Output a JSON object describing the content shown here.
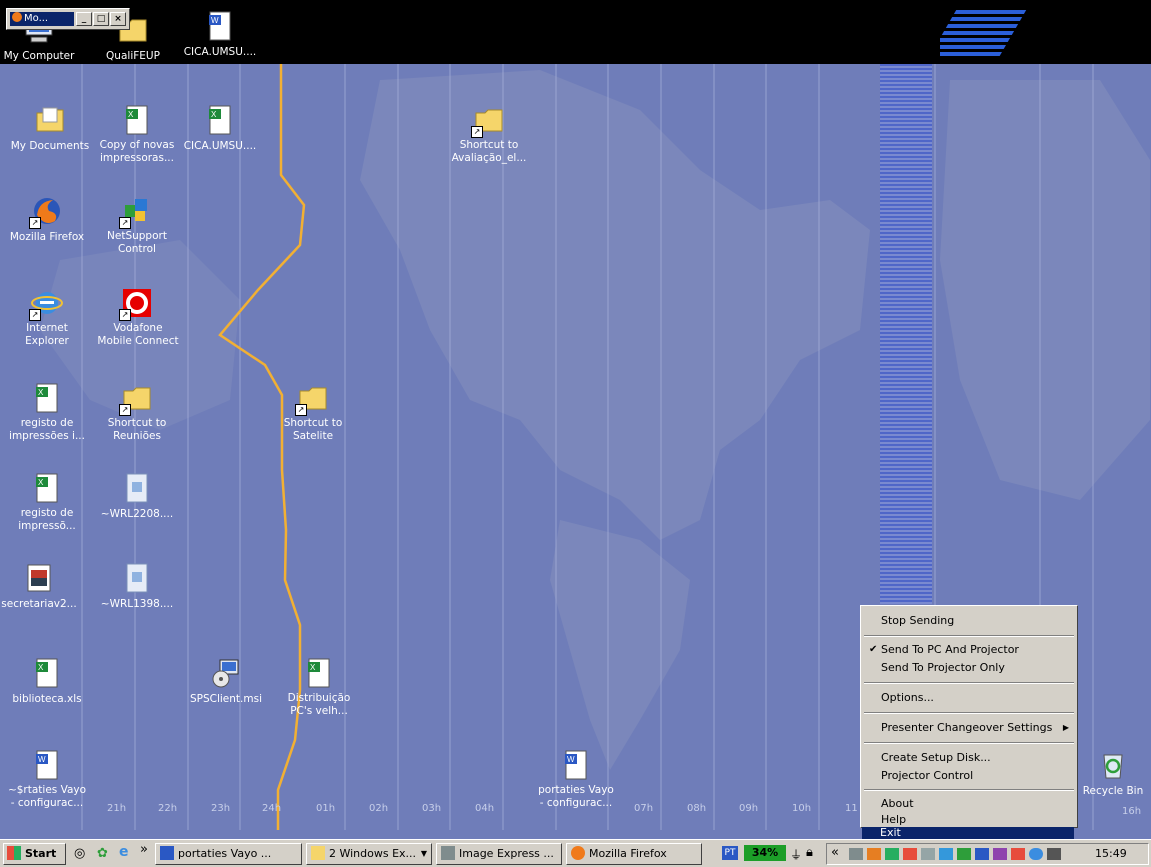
{
  "mini_window": {
    "title": "Mo..."
  },
  "desktop_icons": [
    {
      "label": "My Computer"
    },
    {
      "label": "QualiFEUP"
    },
    {
      "label": "CICA.UMSU...."
    },
    {
      "label": "My Documents"
    },
    {
      "label": "Copy of novas impressoras..."
    },
    {
      "label": "CICA.UMSU...."
    },
    {
      "label": "Shortcut to Avaliação_el..."
    },
    {
      "label": "Mozilla Firefox"
    },
    {
      "label": "NetSupport Control"
    },
    {
      "label": "Internet Explorer"
    },
    {
      "label": "Vodafone Mobile Connect"
    },
    {
      "label": "registo de impressões i..."
    },
    {
      "label": "Shortcut to Reuniões"
    },
    {
      "label": "Shortcut to Satelite"
    },
    {
      "label": "registo de impressõ..."
    },
    {
      "label": "~WRL2208...."
    },
    {
      "label": "secretariav2..."
    },
    {
      "label": "~WRL1398...."
    },
    {
      "label": "biblioteca.xls"
    },
    {
      "label": "SPSClient.msi"
    },
    {
      "label": "Distribuição PC's velh..."
    },
    {
      "label": "~$rtaties Vayo - configurac..."
    },
    {
      "label": "portaties Vayo - configurac..."
    },
    {
      "label": "Recycle Bin"
    }
  ],
  "time_zones": [
    "21h",
    "22h",
    "23h",
    "24h",
    "01h",
    "02h",
    "03h",
    "04h",
    "07h",
    "08h",
    "09h",
    "10h",
    "11",
    "16h"
  ],
  "context_menu": {
    "items": [
      "Stop Sending",
      "Send To PC And Projector",
      "Send To Projector Only",
      "Options...",
      "Presenter Changeover Settings",
      "Create Setup Disk...",
      "Projector Control",
      "About",
      "Help",
      "Exit"
    ]
  },
  "taskbar": {
    "start_label": "Start",
    "chevron": "»",
    "buttons": [
      "portaties Vayo ...",
      "2 Windows Ex...",
      "Image Express ...",
      "Mozilla Firefox"
    ],
    "battery_percent": "34%",
    "tray_chevron": "«",
    "clock": "15:49"
  },
  "colors": {
    "desktop": "#6f7db9",
    "taskbar": "#d4d0c8",
    "selection": "#0a246a",
    "dateline": "#f2b033"
  }
}
